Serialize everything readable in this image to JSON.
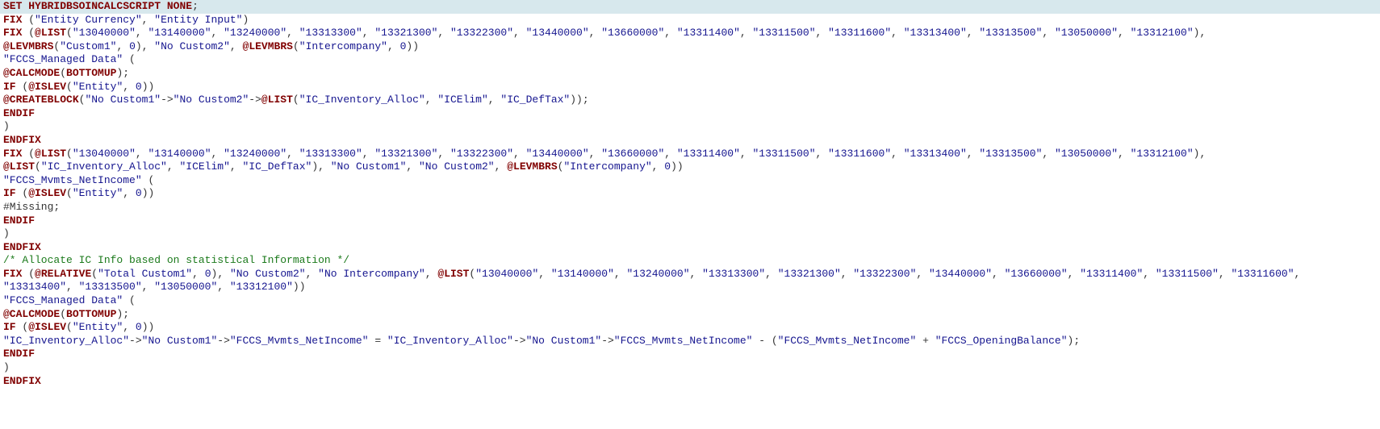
{
  "line1": {
    "set": "SET",
    "hb": "HYBRIDBSOINCALCSCRIPT",
    "none": "NONE",
    "semi": ";"
  },
  "line2": {
    "fix": "FIX",
    "p1": "(",
    "s1": "\"Entity Currency\"",
    "comma": ", ",
    "s2": "\"Entity Input\"",
    "p2": ")"
  },
  "accountList": [
    "\"13040000\"",
    "\"13140000\"",
    "\"13240000\"",
    "\"13313300\"",
    "\"13321300\"",
    "\"13322300\"",
    "\"13440000\"",
    "\"13660000\"",
    "\"13311400\"",
    "\"13311500\"",
    "\"13311600\"",
    "\"13313400\"",
    "\"13313500\"",
    "\"13050000\"",
    "\"13312100\""
  ],
  "funcs": {
    "LIST": "@LIST",
    "LEVMBRS": "@LEVMBRS",
    "CALCMODE": "@CALCMODE",
    "ISLEV": "@ISLEV",
    "CREATEBLOCK": "@CREATEBLOCK",
    "RELATIVE": "@RELATIVE"
  },
  "strs": {
    "Custom1": "\"Custom1\"",
    "NoCustom2": "\"No Custom2\"",
    "Intercompany": "\"Intercompany\"",
    "FCCS_Managed": "\"FCCS_Managed Data\"",
    "BOTTOMUP": "BOTTOMUP",
    "Entity": "\"Entity\"",
    "NoCustom1": "\"No Custom1\"",
    "IC_Inventory_Alloc": "\"IC_Inventory_Alloc\"",
    "ICElim": "\"ICElim\"",
    "IC_DefTax": "\"IC_DefTax\"",
    "FCCS_Mvmts_NetIncome": "\"FCCS_Mvmts_NetIncome\"",
    "NoIntercompany": "\"No Intercompany\"",
    "TotalCustom1": "\"Total Custom1\"",
    "FCCS_OpeningBalance": "\"FCCS_OpeningBalance\"",
    "zero": "0"
  },
  "kw": {
    "FIX": "FIX",
    "ENDFIX": "ENDFIX",
    "IF": "IF",
    "ENDIF": "ENDIF",
    "SET": "SET",
    "NONE": "NONE"
  },
  "misc": {
    "missing": "#Missing;",
    "comment": "/*   Allocate IC Info based on statistical Information */",
    "arrow": "->",
    "eq": " = ",
    "minus": " - ",
    "plus": " + "
  }
}
